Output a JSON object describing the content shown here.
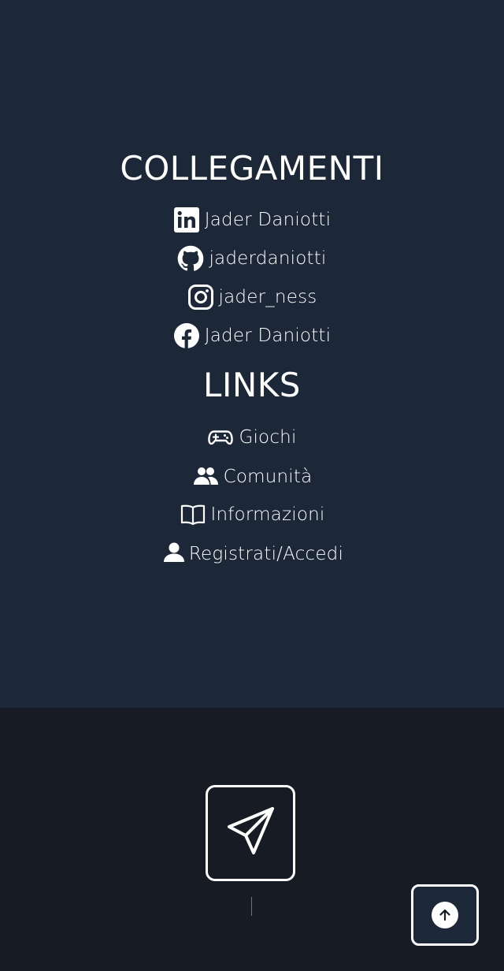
{
  "colors": {
    "top_background": "#1c2738",
    "bottom_background": "#171c24",
    "text": "#ffffff"
  },
  "social": {
    "heading": "COLLEGAMENTI",
    "items": [
      {
        "icon": "linkedin-icon",
        "label": "Jader Daniotti"
      },
      {
        "icon": "github-icon",
        "label": "jaderdaniotti"
      },
      {
        "icon": "instagram-icon",
        "label": "jader_ness"
      },
      {
        "icon": "facebook-icon",
        "label": "Jader Daniotti"
      }
    ]
  },
  "links": {
    "heading": "LINKS",
    "items": [
      {
        "icon": "gamepad-icon",
        "label": "Giochi"
      },
      {
        "icon": "users-icon",
        "label": "Comunità"
      },
      {
        "icon": "book-icon",
        "label": "Informazioni"
      },
      {
        "icon": "user-icon",
        "label": "Registrati/Accedi"
      }
    ]
  },
  "footer": {
    "send_icon": "paper-plane-icon",
    "back_to_top_icon": "arrow-up-icon"
  }
}
